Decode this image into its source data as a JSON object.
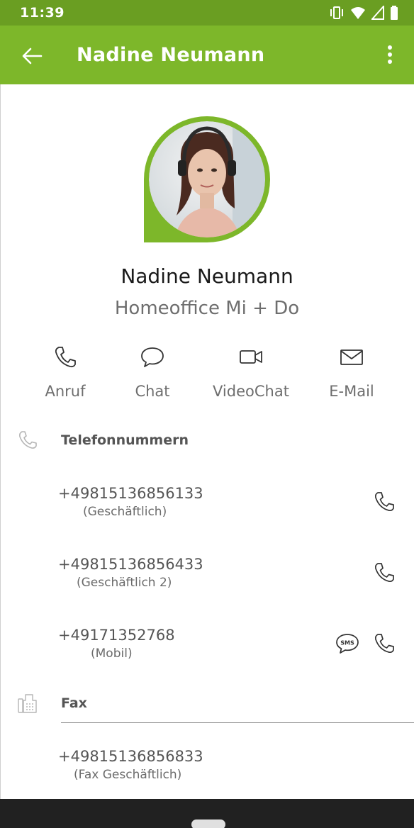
{
  "status_bar": {
    "time": "11:39",
    "icons": [
      "vibrate-icon",
      "wifi-icon",
      "cell-signal-icon",
      "battery-icon"
    ]
  },
  "app_bar": {
    "title": "Nadine Neumann",
    "back_icon": "arrow-left-icon",
    "menu_icon": "more-vertical-icon"
  },
  "contact": {
    "name": "Nadine Neumann",
    "status": "Homeoffice Mi + Do",
    "presence_color": "#7db72a"
  },
  "actions": [
    {
      "label": "Anruf",
      "icon": "phone-icon"
    },
    {
      "label": "Chat",
      "icon": "chat-bubble-icon"
    },
    {
      "label": "VideoChat",
      "icon": "video-camera-icon"
    },
    {
      "label": "E-Mail",
      "icon": "envelope-icon"
    }
  ],
  "sections": {
    "phones": {
      "title": "Telefonnummern",
      "icon": "phone-outline-icon",
      "numbers": [
        {
          "number": "+49815136856133",
          "type": "(Geschäftlich)",
          "sms": false
        },
        {
          "number": "+49815136856433",
          "type": "(Geschäftlich 2)",
          "sms": false
        },
        {
          "number": "+49171352768",
          "type": "(Mobil)",
          "sms": true
        }
      ]
    },
    "fax": {
      "title": "Fax",
      "icon": "fax-icon",
      "numbers": [
        {
          "number": "+49815136856833",
          "type": "(Fax Geschäftlich)"
        }
      ]
    }
  },
  "colors": {
    "app_bar": "#7db72a",
    "status_bar": "#6a9e22",
    "nav_bar": "#212121"
  }
}
